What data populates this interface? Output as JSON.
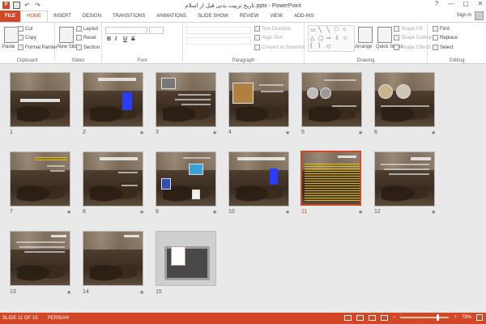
{
  "window": {
    "title": "تاریخ تربیت بدنی قبل از اسلام.pptx - PowerPoint",
    "controls": [
      "?",
      "—",
      "▢",
      "✕"
    ]
  },
  "qat": {
    "app_icon": "P",
    "save_icon": "save-icon",
    "undo_icon": "↶",
    "redo_icon": "↷"
  },
  "tabs": [
    {
      "label": "FILE"
    },
    {
      "label": "HOME"
    },
    {
      "label": "INSERT"
    },
    {
      "label": "DESIGN"
    },
    {
      "label": "TRANSITIONS"
    },
    {
      "label": "ANIMATIONS"
    },
    {
      "label": "SLIDE SHOW"
    },
    {
      "label": "REVIEW"
    },
    {
      "label": "VIEW"
    },
    {
      "label": "ADD-INS"
    }
  ],
  "account": {
    "signin": "Sign in"
  },
  "ribbon": {
    "clipboard": {
      "paste": "Paste",
      "cut": "Cut",
      "copy": "Copy",
      "format_painter": "Format Painter",
      "label": "Clipboard"
    },
    "slides": {
      "new_slide": "New Slide",
      "layout": "Layout",
      "reset": "Reset",
      "section": "Section",
      "label": "Slides"
    },
    "font": {
      "bold": "B",
      "italic": "I",
      "underline": "U",
      "strike": "S",
      "label": "Font"
    },
    "paragraph": {
      "text_direction": "Text Direction",
      "align_text": "Align Text",
      "convert_smartart": "Convert to SmartArt",
      "label": "Paragraph"
    },
    "drawing": {
      "arrange": "Arrange",
      "quick_styles": "Quick Styles",
      "shape_fill": "Shape Fill",
      "shape_outline": "Shape Outline",
      "shape_effects": "Shape Effects",
      "label": "Drawing"
    },
    "editing": {
      "find": "Find",
      "replace": "Replace",
      "select": "Select",
      "label": "Editing"
    }
  },
  "slides": [
    {
      "num": "1",
      "star": ""
    },
    {
      "num": "2",
      "star": "★"
    },
    {
      "num": "3",
      "star": "★"
    },
    {
      "num": "4",
      "star": "★"
    },
    {
      "num": "5",
      "star": "★"
    },
    {
      "num": "6",
      "star": "★"
    },
    {
      "num": "7",
      "star": "★"
    },
    {
      "num": "8",
      "star": "★"
    },
    {
      "num": "9",
      "star": "★"
    },
    {
      "num": "10",
      "star": "★"
    },
    {
      "num": "11",
      "star": "★"
    },
    {
      "num": "12",
      "star": "★"
    },
    {
      "num": "13",
      "star": "★"
    },
    {
      "num": "14",
      "star": "★"
    },
    {
      "num": "15",
      "star": ""
    }
  ],
  "selected_slide": 11,
  "status": {
    "slide_info": "SLIDE 11 OF 15",
    "language": "PERSIAN",
    "zoom": "78%",
    "zoom_minus": "−",
    "zoom_plus": "+",
    "zoom_level": 0.78
  },
  "colors": {
    "accent": "#d24726"
  }
}
